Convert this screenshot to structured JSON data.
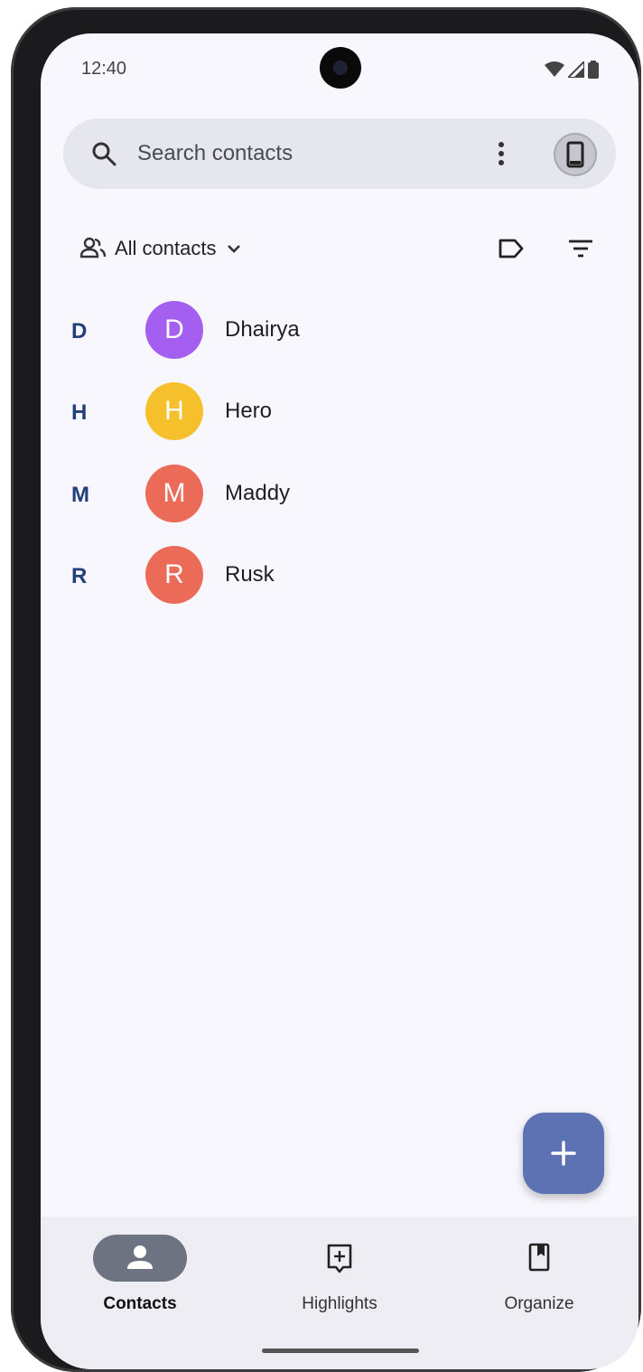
{
  "status_bar": {
    "time": "12:40"
  },
  "search": {
    "placeholder": "Search contacts"
  },
  "toolbar": {
    "filter_label": "All contacts"
  },
  "contacts": [
    {
      "section": "D",
      "initial": "D",
      "name": "Dhairya",
      "color": "#a45ef0"
    },
    {
      "section": "H",
      "initial": "H",
      "name": "Hero",
      "color": "#f5c02c"
    },
    {
      "section": "M",
      "initial": "M",
      "name": "Maddy",
      "color": "#ec6a58"
    },
    {
      "section": "R",
      "initial": "R",
      "name": "Rusk",
      "color": "#ec6a58"
    }
  ],
  "bottom_nav": {
    "items": [
      {
        "label": "Contacts",
        "icon": "person-icon",
        "active": true
      },
      {
        "label": "Highlights",
        "icon": "highlights-icon",
        "active": false
      },
      {
        "label": "Organize",
        "icon": "bookmark-icon",
        "active": false
      }
    ]
  },
  "colors": {
    "accent": "#5c72b3",
    "section_letter": "#24407c",
    "background": "#f8f7fd"
  }
}
